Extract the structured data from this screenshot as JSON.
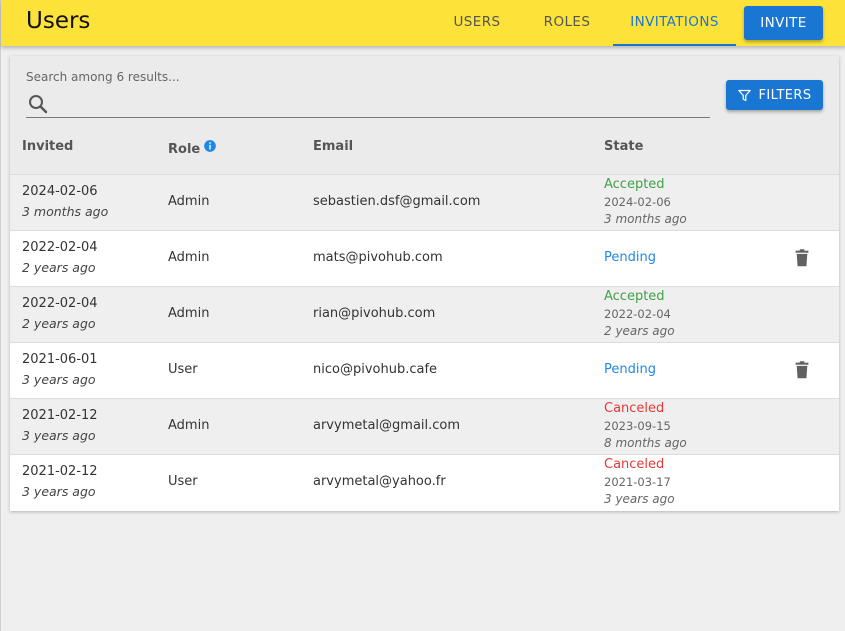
{
  "header": {
    "title": "Users",
    "tabs": [
      {
        "label": "Users",
        "active": false
      },
      {
        "label": "Roles",
        "active": false
      },
      {
        "label": "Invitations",
        "active": true
      }
    ],
    "invite_label": "Invite"
  },
  "toolbar": {
    "search_label": "Search among 6 results...",
    "search_value": "",
    "filters_label": "Filters"
  },
  "table": {
    "columns": [
      "Invited",
      "Role",
      "Email",
      "State"
    ],
    "rows": [
      {
        "invited_date": "2024-02-06",
        "invited_rel": "3 months ago",
        "role": "Admin",
        "email": "sebastien.dsf@gmail.com",
        "state": "Accepted",
        "state_date": "2024-02-06",
        "state_rel": "3 months ago",
        "deletable": false
      },
      {
        "invited_date": "2022-02-04",
        "invited_rel": "2 years ago",
        "role": "Admin",
        "email": "mats@pivohub.com",
        "state": "Pending",
        "state_date": "",
        "state_rel": "",
        "deletable": true
      },
      {
        "invited_date": "2022-02-04",
        "invited_rel": "2 years ago",
        "role": "Admin",
        "email": "rian@pivohub.com",
        "state": "Accepted",
        "state_date": "2022-02-04",
        "state_rel": "2 years ago",
        "deletable": false
      },
      {
        "invited_date": "2021-06-01",
        "invited_rel": "3 years ago",
        "role": "User",
        "email": "nico@pivohub.cafe",
        "state": "Pending",
        "state_date": "",
        "state_rel": "",
        "deletable": true
      },
      {
        "invited_date": "2021-02-12",
        "invited_rel": "3 years ago",
        "role": "Admin",
        "email": "arvymetal@gmail.com",
        "state": "Canceled",
        "state_date": "2023-09-15",
        "state_rel": "8 months ago",
        "deletable": false
      },
      {
        "invited_date": "2021-02-12",
        "invited_rel": "3 years ago",
        "role": "User",
        "email": "arvymetal@yahoo.fr",
        "state": "Canceled",
        "state_date": "2021-03-17",
        "state_rel": "3 years ago",
        "deletable": false
      }
    ]
  },
  "colors": {
    "appbar": "#fde23a",
    "primary": "#1976d2",
    "accepted": "#43a047",
    "pending": "#1e88e5",
    "canceled": "#e53935"
  },
  "icons": {
    "search": "search-icon",
    "filter": "filter-icon",
    "info": "info-icon",
    "delete": "trash-icon"
  }
}
